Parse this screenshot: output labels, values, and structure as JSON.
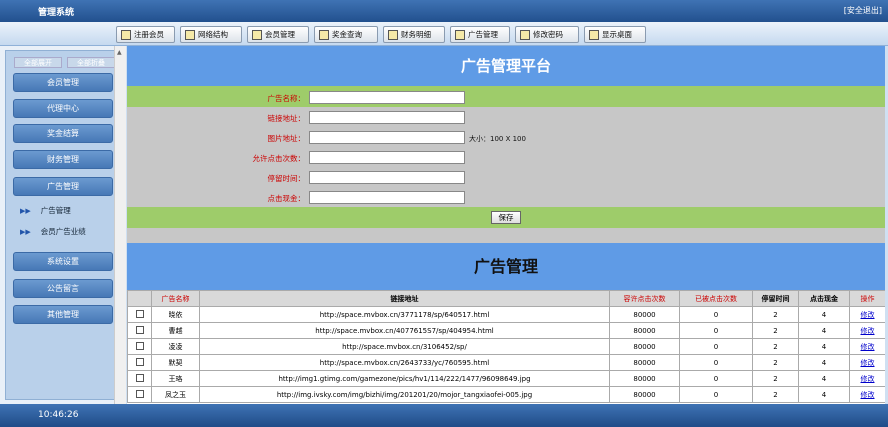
{
  "app": {
    "title": "管理系统",
    "logout": "[安全退出]"
  },
  "toolbar": {
    "items": [
      "注册会员",
      "网络结构",
      "会员管理",
      "奖金查询",
      "财务明细",
      "广告管理",
      "修改密码",
      "显示桌面"
    ]
  },
  "sidebar": {
    "expand_all": "全部展开",
    "collapse_all": "全部折叠",
    "menus": [
      "会员管理",
      "代理中心",
      "奖金结算",
      "财务管理",
      "广告管理",
      "系统设置",
      "公告留言",
      "其他管理"
    ],
    "sub_items": [
      "广告管理",
      "会员广告业绩"
    ]
  },
  "form": {
    "header": "广告管理平台",
    "fields": [
      {
        "label": "广告名称：",
        "value": ""
      },
      {
        "label": "链接地址：",
        "value": ""
      },
      {
        "label": "图片地址：",
        "value": ""
      },
      {
        "label": "允许点击次数：",
        "value": ""
      },
      {
        "label": "停留时间：",
        "value": ""
      },
      {
        "label": "点击现金：",
        "value": ""
      }
    ],
    "image_size_note": "大小：100 X 100",
    "save": "保存"
  },
  "list": {
    "header": "广告管理",
    "columns": [
      "广告名称",
      "链接地址",
      "容许点击次数",
      "已被点击次数",
      "停留时间",
      "点击现金",
      "操作"
    ],
    "rows": [
      {
        "name": "晓依",
        "url": "http://space.mvbox.cn/3771178/sp/640517.html",
        "allowed": "80000",
        "clicked": "0",
        "stay": "2",
        "cash": "4",
        "action": "修改"
      },
      {
        "name": "曹越",
        "url": "http://space.mvbox.cn/4077615S7/sp/404954.html",
        "allowed": "80000",
        "clicked": "0",
        "stay": "2",
        "cash": "4",
        "action": "修改"
      },
      {
        "name": "凌凌",
        "url": "http://space.mvbox.cn/3106452/sp/",
        "allowed": "80000",
        "clicked": "0",
        "stay": "2",
        "cash": "4",
        "action": "修改"
      },
      {
        "name": "默契",
        "url": "http://space.mvbox.cn/2643733/yc/760595.html",
        "allowed": "80000",
        "clicked": "0",
        "stay": "2",
        "cash": "4",
        "action": "修改"
      },
      {
        "name": "王珞",
        "url": "http://img1.gtimg.com/gamezone/pics/hv1/114/222/1477/96098649.jpg",
        "allowed": "80000",
        "clicked": "0",
        "stay": "2",
        "cash": "4",
        "action": "修改"
      },
      {
        "name": "凤之玉",
        "url": "http://img.ivsky.com/img/bizhi/img/201201/20/mojor_tangxiaofei-005.jpg",
        "allowed": "80000",
        "clicked": "0",
        "stay": "2",
        "cash": "4",
        "action": "修改"
      }
    ]
  },
  "status": {
    "time": "10:46:26"
  }
}
